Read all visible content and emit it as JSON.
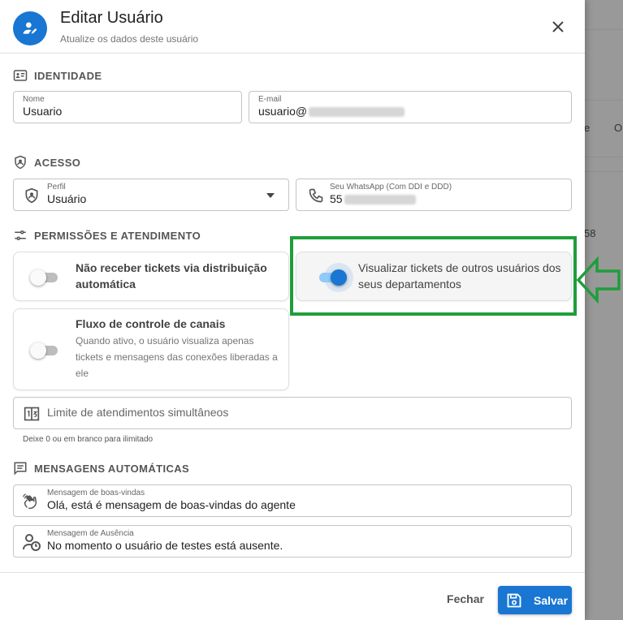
{
  "background": {
    "text_1": "e",
    "text_2": "O",
    "text_3": "58"
  },
  "header": {
    "title": "Editar Usuário",
    "subtitle": "Atualize os dados deste usuário"
  },
  "sections": {
    "identity": "IDENTIDADE",
    "access": "ACESSO",
    "permissions": "PERMISSÕES E ATENDIMENTO",
    "messages": "MENSAGENS AUTOMÁTICAS"
  },
  "fields": {
    "name": {
      "label": "Nome",
      "value": "Usuario"
    },
    "email": {
      "label": "E-mail",
      "value": "usuario@"
    },
    "profile": {
      "label": "Perfil",
      "value": "Usuário"
    },
    "whatsapp": {
      "label": "Seu WhatsApp (Com DDI e DDD)",
      "value": "55"
    },
    "limit": {
      "placeholder": "Limite de atendimentos simultâneos",
      "helper": "Deixe 0 ou em branco para ilimitado"
    },
    "welcome": {
      "label": "Mensagem de boas-vindas",
      "value": "Olá, está é mensagem de boas-vindas do agente"
    },
    "absence": {
      "label": "Mensagem de Ausência",
      "value": "No momento o usuário de testes está ausente."
    }
  },
  "permissions": {
    "no_auto_tickets": {
      "title": "Não receber tickets via distribuição automática",
      "enabled": false
    },
    "view_others": {
      "title": "Visualizar tickets de outros usuários dos seus departamentos",
      "enabled": true
    },
    "channel_flow": {
      "title": "Fluxo de controle de canais",
      "description": "Quando ativo, o usuário visualiza apenas tickets e mensagens das conexões liberadas a ele",
      "enabled": false
    }
  },
  "footer": {
    "close_label": "Fechar",
    "save_label": "Salvar"
  },
  "colors": {
    "primary": "#1976d2",
    "annotation": "#1e9e3a"
  },
  "icons": [
    "user-edit-icon",
    "close-icon",
    "id-card-icon",
    "shield-icon",
    "phone-icon",
    "sliders-icon",
    "counter-icon",
    "message-icon",
    "wave-hand-icon",
    "user-clock-icon",
    "save-icon",
    "arrow-left-icon",
    "chevron-down-icon"
  ]
}
